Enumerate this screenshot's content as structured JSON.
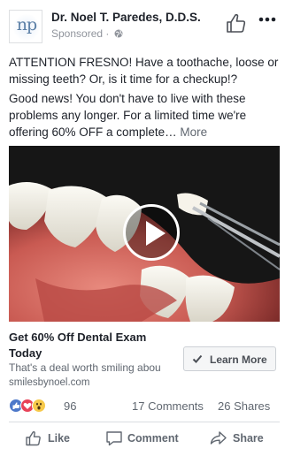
{
  "post": {
    "page_name": "Dr. Noel T. Paredes, D.D.S.",
    "avatar_text": "np",
    "sponsored_label": "Sponsored",
    "separator": "·",
    "text_paragraph_1": "ATTENTION FRESNO! Have a toothache, loose or missing teeth? Or, is it time for a checkup!?",
    "text_paragraph_2": "Good news! You don't have to live with these problems any longer. For a limited time we're offering 60% OFF a complete…",
    "more_link": "More",
    "icons": {
      "avatar": "np-logo",
      "like_page": "thumbs-up-outline-icon",
      "more": "ellipsis-icon",
      "audience": "globe-icon",
      "play": "play-icon"
    }
  },
  "link_card": {
    "title": "Get 60% Off Dental Exam Today",
    "description": "That's a deal worth smiling abou",
    "domain": "smilesbynoel.com",
    "cta_label": "Learn More",
    "cta_icon": "checkmark-icon"
  },
  "stats": {
    "reaction_count": "96",
    "comments": "17 Comments",
    "shares": "26 Shares",
    "reaction_icons": [
      "like-reaction-icon",
      "love-reaction-icon",
      "wow-reaction-icon"
    ]
  },
  "actions": {
    "like": "Like",
    "comment": "Comment",
    "share": "Share"
  },
  "colors": {
    "text_primary": "#1d2129",
    "text_secondary": "#606770",
    "meta_gray": "#90949c",
    "like_blue": "#4d78c9",
    "love_red": "#e84258",
    "wow_yellow": "#f7c94a"
  }
}
